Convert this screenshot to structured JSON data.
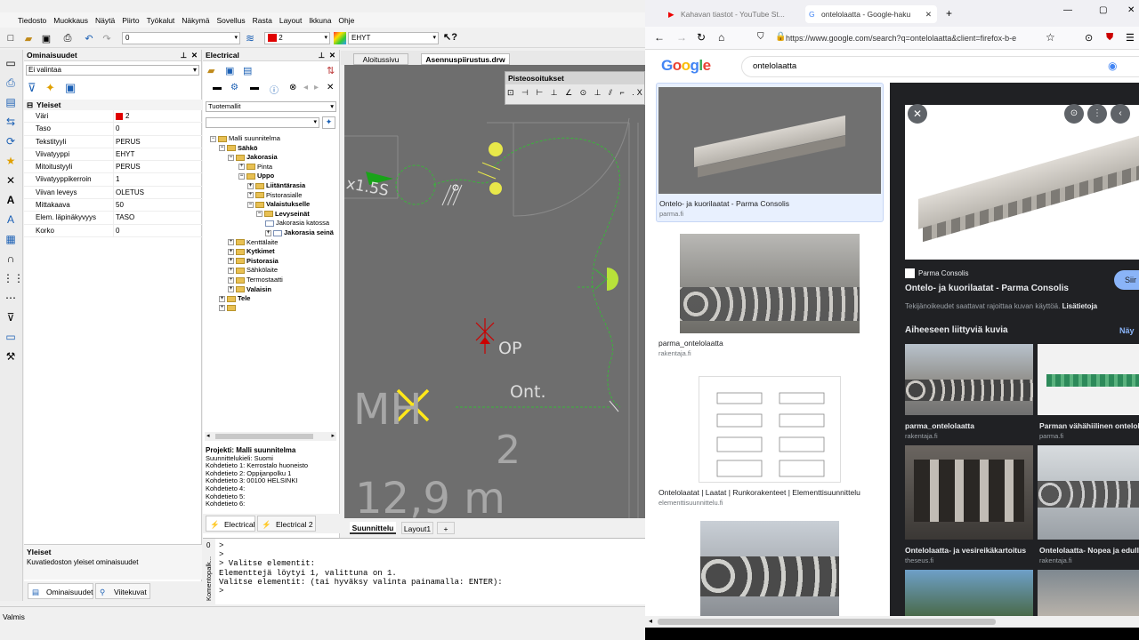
{
  "cad": {
    "menu": [
      "Tiedosto",
      "Muokkaus",
      "Näytä",
      "Piirto",
      "Työkalut",
      "Näkymä",
      "Sovellus",
      "Rasta",
      "Layout",
      "Ikkuna",
      "Ohje"
    ],
    "toolbar": {
      "layer_value": "0",
      "color_value": "2",
      "linetype_value": "EHYT",
      "color_hex": "#e00000"
    },
    "properties": {
      "title": "Ominaisuudet",
      "selection": "Ei valintaa",
      "section": "Yleiset",
      "rows": [
        {
          "k": "Väri",
          "v": "2"
        },
        {
          "k": "Taso",
          "v": "0"
        },
        {
          "k": "Tekstityyli",
          "v": "PERUS"
        },
        {
          "k": "Viivatyyppi",
          "v": "EHYT"
        },
        {
          "k": "Mitoitustyyli",
          "v": "PERUS"
        },
        {
          "k": "Viivatyyppikerroin",
          "v": "1"
        },
        {
          "k": "Viivan leveys",
          "v": "OLETUS"
        },
        {
          "k": "Mittakaava",
          "v": "50"
        },
        {
          "k": "Elem. läpinäkyvyys",
          "v": "TASO"
        },
        {
          "k": "Korko",
          "v": "0"
        }
      ],
      "desc_title": "Yleiset",
      "desc_text": "Kuvatiedoston yleiset ominaisuudet",
      "tab1": "Ominaisuudet",
      "tab2": "Viitekuvat"
    },
    "electrical": {
      "title": "Electrical",
      "filter": "Tuotemallit",
      "tree": [
        {
          "t": "Malli suunnitelma",
          "b": false
        },
        {
          "t": "Sähkö",
          "b": true
        },
        {
          "t": "Jakorasia",
          "b": true
        },
        {
          "t": "Pinta",
          "b": false
        },
        {
          "t": "Uppo",
          "b": true
        },
        {
          "t": "Liitäntärasia",
          "b": true
        },
        {
          "t": "Pistorasialle",
          "b": false
        },
        {
          "t": "Valaistukselle",
          "b": true
        },
        {
          "t": "Levyseinät",
          "b": true
        },
        {
          "t": "Jakorasia katossa",
          "b": false
        },
        {
          "t": "Jakorasia seinä",
          "b": true
        },
        {
          "t": "Kenttälaite",
          "b": false
        },
        {
          "t": "Kytkimet",
          "b": true
        },
        {
          "t": "Pistorasia",
          "b": true
        },
        {
          "t": "Sähkölaite",
          "b": false
        },
        {
          "t": "Termostaatti",
          "b": false
        },
        {
          "t": "Valaisin",
          "b": true
        },
        {
          "t": "Tele",
          "b": true
        },
        {
          "t": "",
          "b": false
        }
      ],
      "project_title": "Projekti: Malli suunnitelma",
      "project_lines": [
        "Suunnittelukieli: Suomi",
        "Kohdetieto 1: Kerrostalo huoneisto",
        "Kohdetieto 2: Oppijanpolku 1",
        "Kohdetieto 3: 00100 HELSINKI",
        "Kohdetieto 4:",
        "Kohdetieto 5:",
        "Kohdetieto 6:"
      ],
      "tab1": "Electrical",
      "tab2": "Electrical 2"
    },
    "doc_tabs": [
      "Aloitussivu",
      "Asennuspiirustus.drw"
    ],
    "pisteosoitukset": "Pisteosoitukset",
    "drawing_texts": {
      "x15s": "x1.5S",
      "op": "OP",
      "ont": "Ont.",
      "mh": "MH",
      "two": "2",
      "area": "12,9 m"
    },
    "layout_tabs": [
      "Suunnittelu",
      "Layout1",
      "+"
    ],
    "cmd_side_label": "Komentopalk...",
    "cmd_lines": [
      "> ",
      "> ",
      "> Valitse elementit:",
      "Elementtejä löytyi 1, valittuna on 1.",
      "Valitse elementit: (tai hyväksy valinta painamalla: ENTER):",
      "",
      "> "
    ],
    "cmd_gutter": "0",
    "status": "Valmis"
  },
  "browser": {
    "tabs": [
      "Kahavan tiastot - YouTube St...",
      "ontelolaatta - Google-haku"
    ],
    "url": "https://www.google.com/search?q=ontelolaatta&client=firefox-b-e",
    "logo": "Google",
    "query": "ontelolaatta",
    "results": [
      {
        "caption": "Ontelo- ja kuorilaatat - Parma Consolis",
        "source": "parma.fi"
      },
      {
        "caption": "parma_ontelolaatta",
        "source": "rakentaja.fi"
      },
      {
        "caption": "Ontelolaatat | Laatat | Runkorakenteet | Elementtisuunnittelu",
        "source": "elementtisuunnittelu.fi"
      }
    ],
    "preview": {
      "source": "Parma Consolis",
      "title": "Ontelo- ja kuorilaatat - Parma Consolis",
      "visit": "Siir",
      "notice": "Tekijänoikeudet saattavat rajoittaa kuvan käyttöä.",
      "more": "Lisätietoja",
      "related_title": "Aiheeseen liittyviä kuvia",
      "related_more": "Näy",
      "related": [
        {
          "caption": "parma_ontelolaatta",
          "source": "rakentaja.fi"
        },
        {
          "caption": "Parman vähähiilinen ontelola",
          "source": "parma.fi"
        },
        {
          "caption": "Ontelolaatta- ja vesireikäkartoitus",
          "source": "theseus.fi"
        },
        {
          "caption": "Ontelolaatta- Nopea ja edullin",
          "source": "rakentaja.fi"
        }
      ]
    }
  }
}
